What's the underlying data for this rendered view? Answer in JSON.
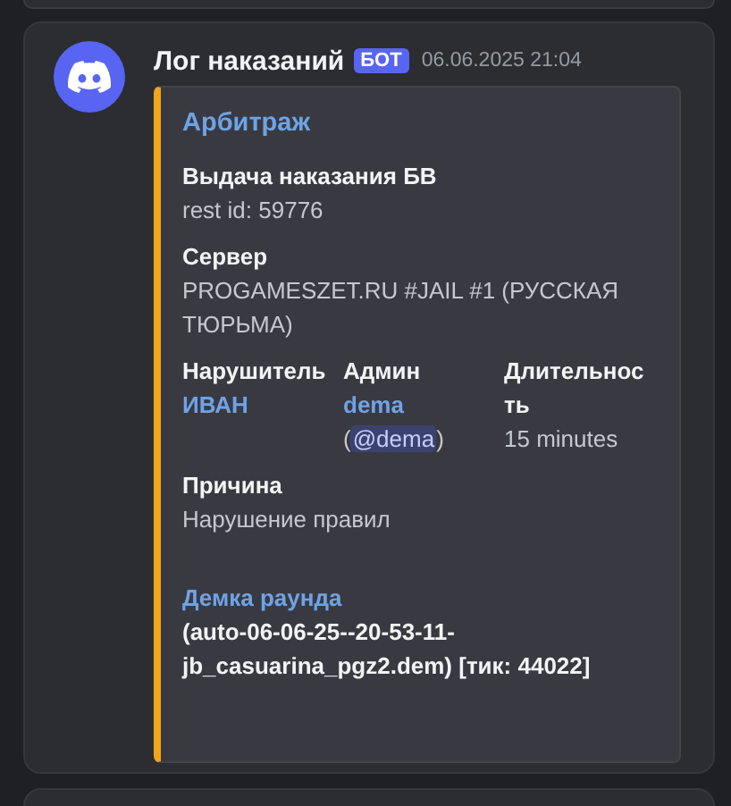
{
  "message": {
    "author": "Лог наказаний",
    "badge": "БОТ",
    "timestamp": "06.06.2025 21:04",
    "embed": {
      "title": "Арбитраж",
      "fields": [
        {
          "kind": "plain",
          "inline": false,
          "name": "Выдача наказания БВ",
          "lines": [
            [
              {
                "kind": "text",
                "text": "rest id: 59776"
              }
            ]
          ]
        },
        {
          "kind": "plain",
          "inline": false,
          "name": "Сервер",
          "lines": [
            [
              {
                "kind": "text",
                "text": "PROGAMESZET.RU #JAIL #1 (РУССКАЯ ТЮРЬМА)"
              }
            ]
          ]
        },
        {
          "kind": "plain",
          "inline": true,
          "name": "Нарушитель",
          "lines": [
            [
              {
                "kind": "link",
                "text": "ИВАН"
              }
            ]
          ]
        },
        {
          "kind": "plain",
          "inline": true,
          "name": "Админ",
          "lines": [
            [
              {
                "kind": "link",
                "text": "dema"
              }
            ],
            [
              {
                "kind": "text",
                "text": "("
              },
              {
                "kind": "mention",
                "text": "@dema"
              },
              {
                "kind": "text",
                "text": ")"
              }
            ]
          ]
        },
        {
          "kind": "plain",
          "inline": true,
          "name": "Длительность",
          "lines": [
            [
              {
                "kind": "text",
                "text": "15 minutes"
              }
            ]
          ]
        },
        {
          "kind": "plain",
          "inline": false,
          "name": "Причина",
          "lines": [
            [
              {
                "kind": "text",
                "text": "Нарушение правил"
              }
            ]
          ]
        },
        {
          "kind": "highlight",
          "inline": false,
          "name": "Демка раунда",
          "lines": [
            [
              {
                "kind": "strong",
                "text": "(auto-06-06-25--20-53-11-jb_casuarina_pgz2.dem) [тик: 44022]"
              }
            ]
          ]
        }
      ]
    }
  }
}
